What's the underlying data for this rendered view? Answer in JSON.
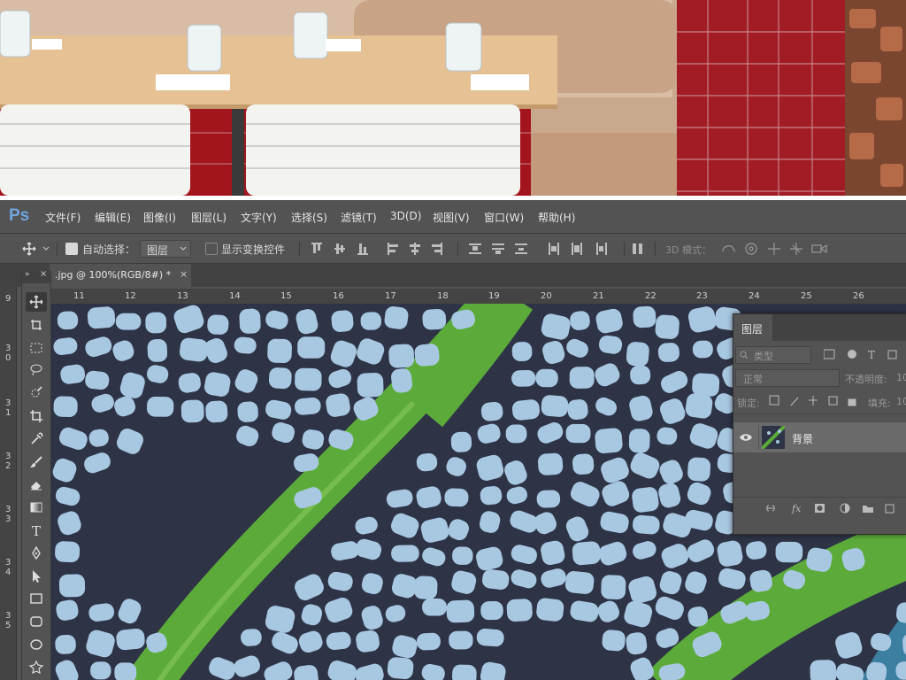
{
  "app": {
    "logo": "Ps"
  },
  "menu": [
    "文件(F)",
    "编辑(E)",
    "图像(I)",
    "图层(L)",
    "文字(Y)",
    "选择(S)",
    "滤镜(T)",
    "3D(D)",
    "视图(V)",
    "窗口(W)",
    "帮助(H)"
  ],
  "options": {
    "auto_select_label": "自动选择：",
    "auto_select_value": "图层",
    "show_transform_label": "显示变换控件",
    "mode_3d_label": "3D 模式："
  },
  "document": {
    "tab_title": ".jpg @ 100%(RGB/8#) *",
    "close": "×"
  },
  "rulers": {
    "h": [
      "11",
      "12",
      "13",
      "14",
      "15",
      "16",
      "17",
      "18",
      "19",
      "20",
      "21",
      "22",
      "23",
      "24",
      "25",
      "26"
    ],
    "v": [
      "9",
      "3 0",
      "3 1",
      "3 2",
      "3 3",
      "3 4",
      "3 5"
    ]
  },
  "tools": [
    "move-icon",
    "artboard-icon",
    "marquee-icon",
    "lasso-icon",
    "quick-select-icon",
    "crop-icon",
    "eyedropper-icon",
    "brush-icon",
    "eraser-icon",
    "gradient-icon",
    "type-icon",
    "pen-icon",
    "path-select-icon",
    "rectangle-icon",
    "rounded-rect-icon",
    "ellipse-icon",
    "custom-shape-icon"
  ],
  "tool_type_glyph": "T",
  "layers_panel": {
    "title": "图层",
    "filter_label": "类型",
    "blend_mode": "正常",
    "opacity_label": "不透明度:",
    "opacity_value": "10",
    "lock_label": "锁定:",
    "fill_label": "填充:",
    "fill_value": "10",
    "layers": [
      {
        "name": "背景",
        "visible": true
      }
    ]
  },
  "colors": {
    "ui_bg": "#535353",
    "dark": "#424242",
    "canvas_bg": "#2e3446",
    "dots": "#a8c8e2",
    "green": "#5cab3a",
    "accent": "#6fa6de"
  }
}
